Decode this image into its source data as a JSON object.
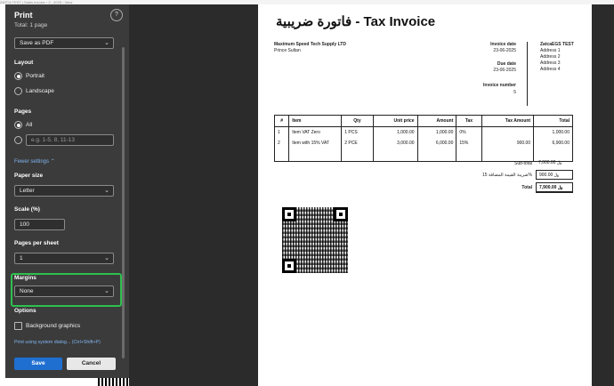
{
  "top": {
    "crumb": "ZATCA TEST | Sales Invoice  ›  Z...2025  ›  View"
  },
  "panel": {
    "title": "Print",
    "subtitle": "Total: 1 page",
    "help": "?",
    "destination": "Save as PDF",
    "layout": {
      "label": "Layout",
      "options": [
        "Portrait",
        "Landscape"
      ],
      "selected": "Portrait"
    },
    "pages": {
      "label": "Pages",
      "all": "All",
      "placeholder": "e.g. 1-5, 8, 11-13"
    },
    "fewer_settings": "Fewer settings",
    "paper_size": {
      "label": "Paper size",
      "value": "Letter"
    },
    "scale": {
      "label": "Scale (%)",
      "value": "100"
    },
    "pages_per_sheet": {
      "label": "Pages per sheet",
      "value": "1"
    },
    "margins": {
      "label": "Margins",
      "value": "None"
    },
    "options": {
      "label": "Options",
      "background_graphics": "Background graphics"
    },
    "system_dialog": "Print using system dialog... (Ctrl+Shift+P)",
    "save": "Save",
    "cancel": "Cancel"
  },
  "invoice": {
    "title": "فاتورة ضريبية - Tax Invoice",
    "seller_name": "Maximum Speed Tech Supply LTD",
    "seller_line": "Prince Sultan",
    "invoice_date_label": "Invoice date",
    "invoice_date": "23-06-2025",
    "due_date_label": "Due date",
    "due_date": "23-06-2025",
    "invoice_number_label": "Invoice number",
    "invoice_number": "5",
    "buyer_name": "ZatcaEGS TEST",
    "buyer_address": [
      "Address 1",
      "Address 2",
      "Address 3",
      "Address 4"
    ],
    "columns": [
      "#",
      "Item",
      "Qty",
      "Unit price",
      "Amount",
      "Tax",
      "Tax Amount",
      "Total"
    ],
    "rows": [
      [
        "1",
        "Item VAT Zero",
        "1 PCS",
        "1,000.00",
        "1,000.00",
        "0%",
        "",
        "1,000.00"
      ],
      [
        "2",
        "Item with 15% VAT",
        "2 PCE",
        "3,000.00",
        "6,000.00",
        "15%",
        "900.00",
        "6,900.00"
      ]
    ],
    "subtotal_label": "Sub-total",
    "subtotal": "7,000.00 ﷼",
    "vat_label": "ضريبة القيمة المضافة 15%",
    "vat": "900.00 ﷼",
    "total_label": "Total",
    "total": "7,900.00 ﷼"
  },
  "colors": {
    "panel": "#3b3b3b",
    "accent": "#1f6fd1",
    "highlight": "#2fbf4f",
    "preview_bg": "#2b2b2b"
  }
}
